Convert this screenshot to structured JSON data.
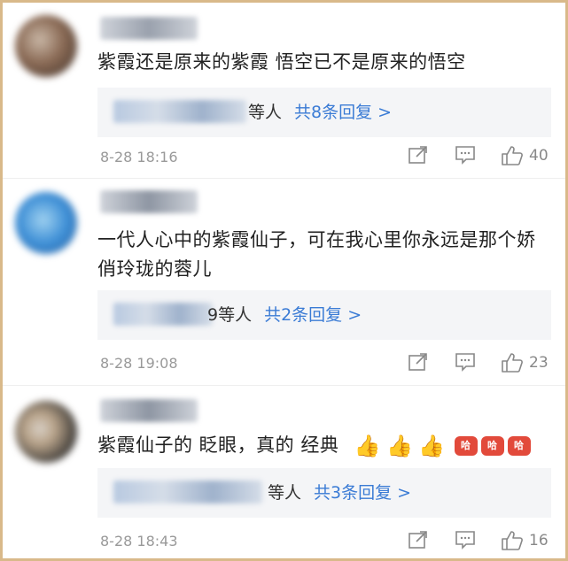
{
  "comments": [
    {
      "text": "紫霞还是原来的紫霞 悟空已不是原来的悟空",
      "reply_who": "等人",
      "reply_count": "共8条回复 >",
      "time": "8-28 18:16",
      "likes": "40",
      "avatar_colors": [
        "#8a6a55",
        "#c9b7a6",
        "#3b2f28"
      ]
    },
    {
      "text": "一代人心中的紫霞仙子，可在我心里你永远是那个娇俏玲珑的蓉儿",
      "reply_who": "9等人",
      "reply_count": "共2条回复 >",
      "time": "8-28 19:08",
      "likes": "23",
      "avatar_colors": [
        "#3e8fd6",
        "#9fd1f0",
        "#2a5d9a"
      ]
    },
    {
      "text": "紫霞仙子的 眨眼，真的 经典",
      "reply_who": "等人",
      "reply_count": "共3条回复 >",
      "time": "8-28 18:43",
      "likes": "16",
      "avatar_colors": [
        "#2b2b2b",
        "#b8a38a",
        "#d8d0c6"
      ]
    }
  ],
  "emojis": {
    "thumbs": [
      "👍",
      "👍",
      "👍"
    ],
    "laugh": [
      "哈",
      "哈",
      "哈"
    ]
  },
  "icons": {
    "share": "share-icon",
    "comment": "comment-icon",
    "like": "thumbs-up-icon"
  },
  "colors": {
    "link": "#3a7bd5",
    "reply_bg": "#f4f5f7",
    "frame": "#d9b98a"
  }
}
